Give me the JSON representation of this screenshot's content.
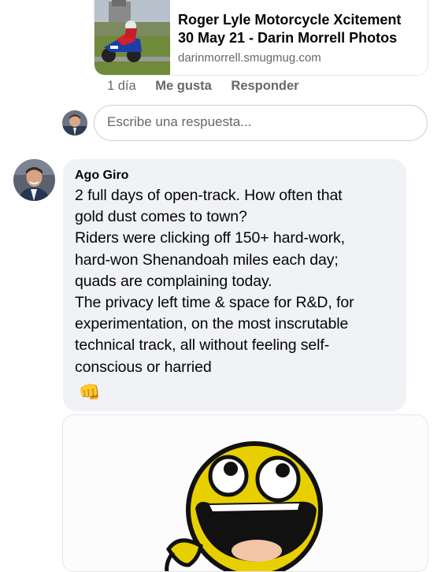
{
  "link_preview": {
    "title": "Roger Lyle Motorcycle Xcitement\n30 May 21 - Darin Morrell Photos",
    "domain": "darinmorrell.smugmug.com"
  },
  "reply_actions": {
    "time": "1 día",
    "like": "Me gusta",
    "reply": "Responder"
  },
  "reply_input": {
    "placeholder": "Escribe una respuesta..."
  },
  "comment": {
    "author": "Ago Giro",
    "text": "2 full days of open-track. How often that\ngold dust comes to town?\nRiders were clicking off 150+ hard-work,\nhard-won Shenandoah miles each day;\nquads are complaining today.\nThe privacy left time & space for R&D, for\nexperimentation, on the most inscrutable\ntechnical track, all without feeling self-\nconscious or harried",
    "emoji": "👊"
  },
  "colors": {
    "bubble_bg": "#f0f2f5",
    "secondary_text": "#65676b",
    "face_yellow": "#e8d000"
  },
  "icons": {
    "fist": "oncoming-fist-emoji",
    "meme": "awesome-face-meme"
  }
}
